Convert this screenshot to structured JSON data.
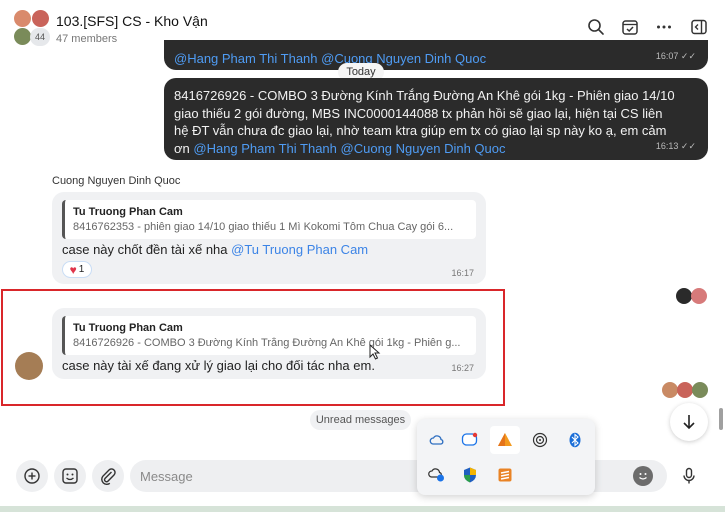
{
  "header": {
    "title": "103.[SFS] CS - Kho Vận",
    "members": "47 members",
    "avatar_count": "44"
  },
  "top_message": {
    "mentions": "@Hang Pham Thi Thanh @Cuong Nguyen Dinh Quoc",
    "time": "16:07"
  },
  "date_divider": "Today",
  "message1": {
    "text": "8416726926 - COMBO 3 Đường Kính Trắng Đường An Khê gói 1kg - Phiên giao 14/10 giao thiếu 2 gói đường, MBS INC0000144088 tx phản hồi sẽ giao lại, hiện tại CS liên hệ ĐT vẫn chưa đc giao lại, nhờ team ktra giúp em tx có giao lại sp này ko ạ, em cảm ơn ",
    "mention1": "@Hang Pham Thi Thanh",
    "mention2": "@Cuong Nguyen Dinh Quoc",
    "time": "16:13"
  },
  "message2": {
    "sender": "Cuong Nguyen Dinh Quoc",
    "quote_author": "Tu Truong Phan Cam",
    "quote_text": "8416762353 - phiên giao 14/10 giao thiếu 1 Mì Kokomi Tôm Chua Cay gói 6...",
    "text": "case này chốt đền tài xế nha ",
    "mention": "@Tu Truong Phan Cam",
    "reaction_count": "1",
    "time": "16:17"
  },
  "message3": {
    "quote_author": "Tu Truong Phan Cam",
    "quote_text": "8416726926 - COMBO 3 Đường Kính Trắng Đường An Khê gói 1kg - Phiên g...",
    "text": "case này tài xế đang xử lý giao lại cho đối tác nha em.",
    "time": "16:27"
  },
  "unread_label": "Unread messages",
  "composer": {
    "placeholder": "Message"
  },
  "colors": {
    "highlight_border": "#d9262a",
    "mention": "#4f9cf4",
    "dark_bubble": "#2b2b2b"
  },
  "icons": {
    "header": [
      "search-icon",
      "calendar-check-icon",
      "more-icon",
      "sidebar-toggle-icon"
    ],
    "composer": [
      "add-icon",
      "sticker-icon",
      "attach-icon",
      "emoji-icon",
      "mic-icon"
    ],
    "tray": [
      "onedrive-icon",
      "zalo-icon",
      "app-orange-icon",
      "network-icon",
      "bluetooth-icon",
      "vpn-icon",
      "defender-icon",
      "sublime-icon"
    ]
  }
}
